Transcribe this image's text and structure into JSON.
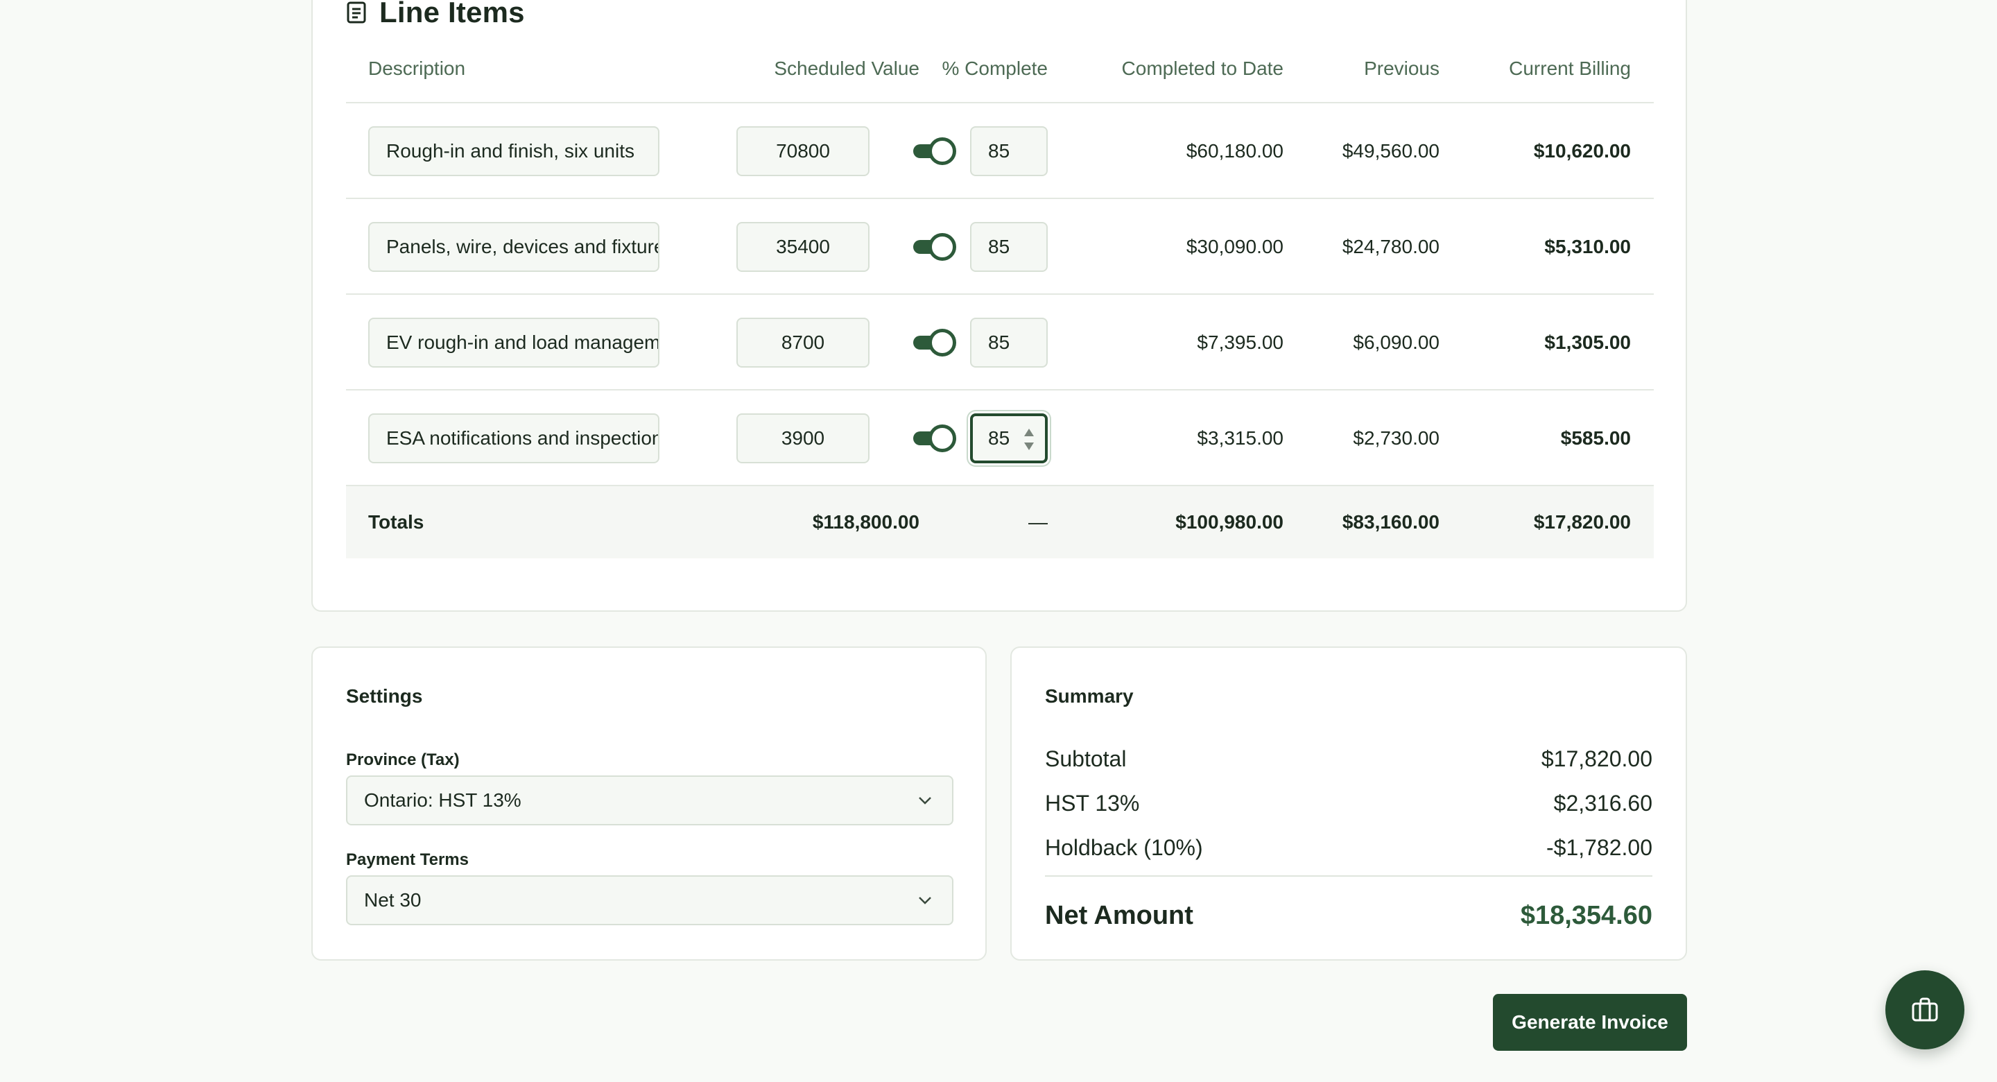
{
  "line_items": {
    "title": "Line Items",
    "icon": "document-list-icon",
    "columns": {
      "description": "Description",
      "scheduled_value": "Scheduled Value",
      "percent_complete": "% Complete",
      "completed_to_date": "Completed to Date",
      "previous": "Previous",
      "current_billing": "Current Billing"
    },
    "rows": [
      {
        "description": "Rough-in and finish, six units",
        "scheduled_value": "70800",
        "percent": "85",
        "completed_to_date": "$60,180.00",
        "previous": "$49,560.00",
        "current_billing": "$10,620.00"
      },
      {
        "description": "Panels, wire, devices and fixtures",
        "scheduled_value": "35400",
        "percent": "85",
        "completed_to_date": "$30,090.00",
        "previous": "$24,780.00",
        "current_billing": "$5,310.00"
      },
      {
        "description": "EV rough-in and load management",
        "scheduled_value": "8700",
        "percent": "85",
        "completed_to_date": "$7,395.00",
        "previous": "$6,090.00",
        "current_billing": "$1,305.00"
      },
      {
        "description": "ESA notifications and inspections",
        "scheduled_value": "3900",
        "percent": "85",
        "completed_to_date": "$3,315.00",
        "previous": "$2,730.00",
        "current_billing": "$585.00"
      }
    ],
    "totals": {
      "label": "Totals",
      "scheduled_value": "$118,800.00",
      "percent": "—",
      "completed_to_date": "$100,980.00",
      "previous": "$83,160.00",
      "current_billing": "$17,820.00"
    }
  },
  "settings": {
    "title": "Settings",
    "province_label": "Province (Tax)",
    "province_value": "Ontario: HST 13%",
    "terms_label": "Payment Terms",
    "terms_value": "Net 30"
  },
  "summary": {
    "title": "Summary",
    "subtotal_label": "Subtotal",
    "subtotal_value": "$17,820.00",
    "tax_label": "HST 13%",
    "tax_value": "$2,316.60",
    "holdback_label": "Holdback (10%)",
    "holdback_value": "-$1,782.00",
    "net_label": "Net Amount",
    "net_value": "$18,354.60"
  },
  "actions": {
    "generate_label": "Generate Invoice",
    "fab_icon": "toolbox-icon"
  },
  "colors": {
    "accent": "#234a2e",
    "toggle": "#2d5a3a",
    "border": "#d8e0d6",
    "background": "#f8faf7"
  }
}
